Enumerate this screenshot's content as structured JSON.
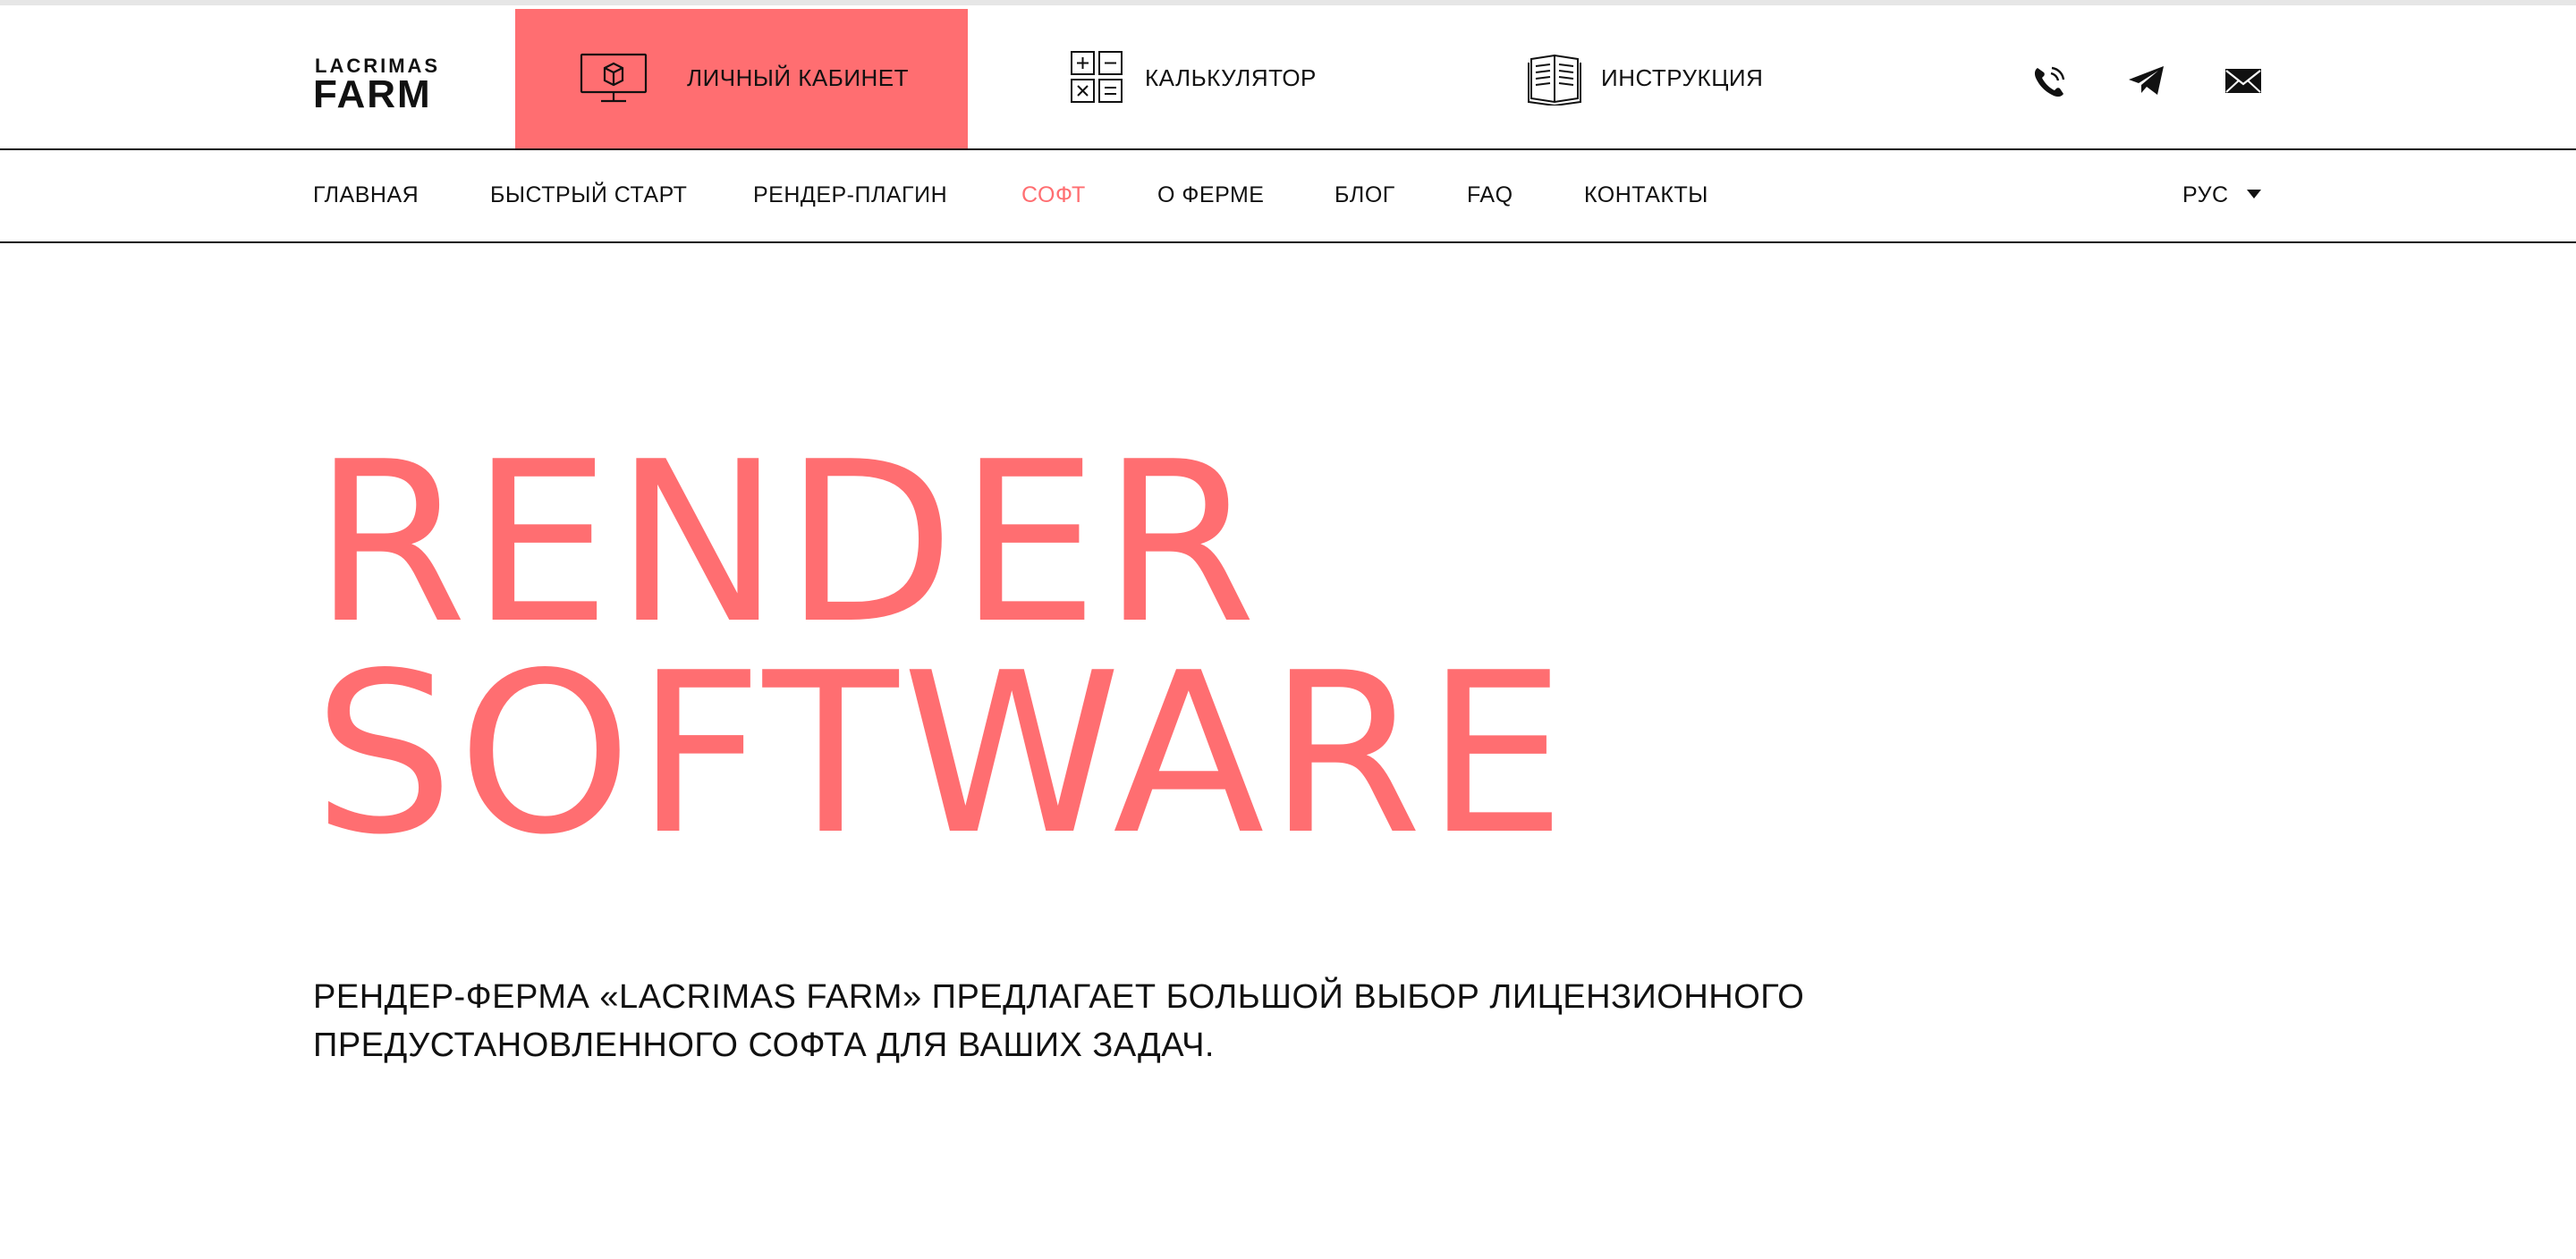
{
  "colors": {
    "accent": "#ff6e71",
    "text": "#111111",
    "background": "#ffffff"
  },
  "logo": {
    "line1": "LACRIMAS",
    "line2": "FARM"
  },
  "topbar": {
    "cabinet": {
      "label": "ЛИЧНЫЙ КАБИНЕТ",
      "icon": "monitor-cube-icon"
    },
    "calculator": {
      "label": "КАЛЬКУЛЯТОР",
      "icon": "calculator-icon"
    },
    "instructions": {
      "label": "ИНСТРУКЦИЯ",
      "icon": "book-icon"
    },
    "contacts": [
      {
        "icon": "phone-icon"
      },
      {
        "icon": "telegram-icon"
      },
      {
        "icon": "mail-icon"
      }
    ]
  },
  "nav": {
    "items": [
      {
        "label": "ГЛАВНАЯ"
      },
      {
        "label": "БЫСТРЫЙ СТАРТ"
      },
      {
        "label": "РЕНДЕР-ПЛАГИН"
      },
      {
        "label": "СОФТ",
        "active": true
      },
      {
        "label": "О ФЕРМЕ"
      },
      {
        "label": "БЛОГ"
      },
      {
        "label": "FAQ"
      },
      {
        "label": "КОНТАКТЫ"
      }
    ],
    "language": {
      "selected": "РУС",
      "icon": "caret-down-icon"
    }
  },
  "hero": {
    "title_line1": "RENDER",
    "title_line2": "SOFTWARE",
    "subtitle_line1": "РЕНДЕР-ФЕРМА «LACRIMAS FARM» ПРЕДЛАГАЕТ БОЛЬШОЙ ВЫБОР ЛИЦЕНЗИОННОГО",
    "subtitle_line2": "ПРЕДУСТАНОВЛЕННОГО СОФТА ДЛЯ ВАШИХ ЗАДАЧ."
  }
}
